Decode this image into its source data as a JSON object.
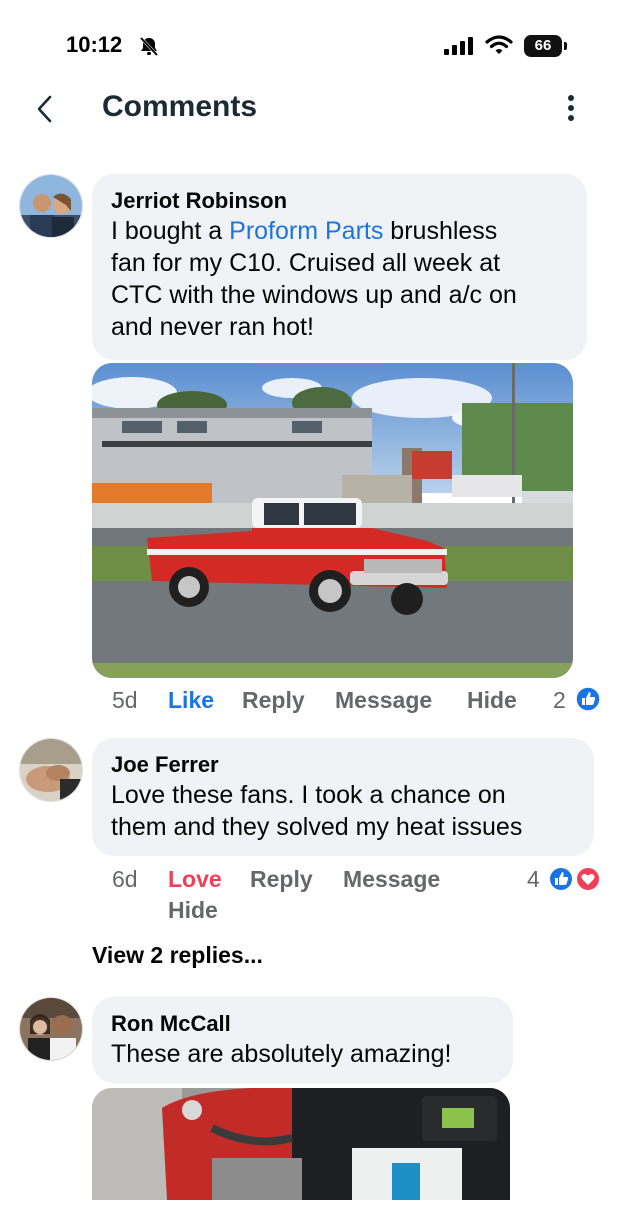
{
  "status_bar": {
    "time": "10:12",
    "battery": "66"
  },
  "header": {
    "title": "Comments"
  },
  "comments": [
    {
      "author": "Jerriot Robinson",
      "text_before": "I bought a ",
      "link": "Proform Parts",
      "text_line1_after": " brushless",
      "text_line2": "fan for my C10. Cruised all week at",
      "text_line3": "CTC with the windows up and a/c on",
      "text_line4": "and never ran hot!",
      "age": "5d",
      "reaction_label": "Like",
      "reply": "Reply",
      "message": "Message",
      "hide": "Hide",
      "reaction_count": "2"
    },
    {
      "author": "Joe Ferrer",
      "text_line1": "Love these fans. I took a chance on",
      "text_line2": "them and they solved my heat issues",
      "age": "6d",
      "reaction_label": "Love",
      "reply": "Reply",
      "message": "Message",
      "hide": "Hide",
      "reaction_count": "4",
      "view_replies": "View 2 replies..."
    },
    {
      "author": "Ron McCall",
      "text_line1": "These are absolutely amazing!"
    }
  ],
  "colors": {
    "like_blue": "#1b74e4",
    "love_red": "#f33e58",
    "bubble_bg": "#f0f2f5"
  }
}
